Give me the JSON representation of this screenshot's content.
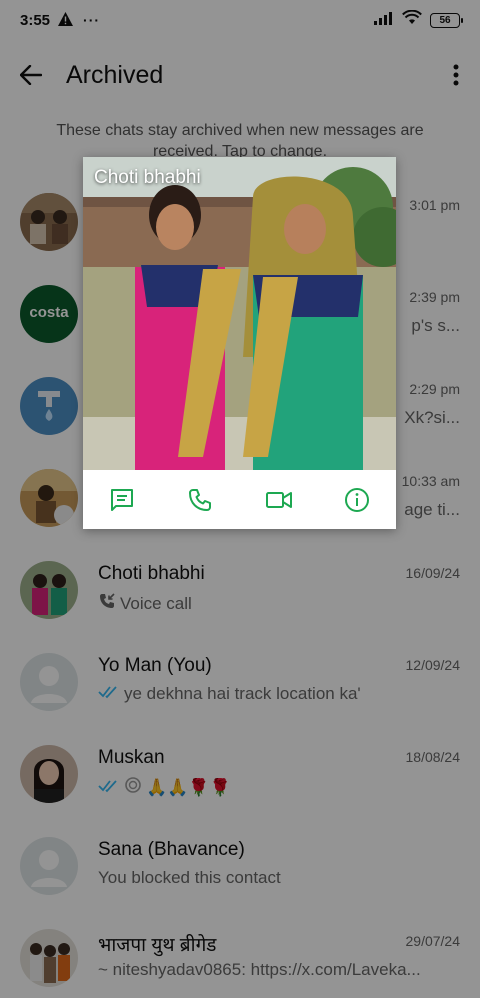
{
  "status_bar": {
    "time": "3:55",
    "battery": "56"
  },
  "header": {
    "title": "Archived"
  },
  "info_text": "These chats stay archived when new messages are received. Tap to change.",
  "chats": [
    {
      "name": "",
      "time": "3:01 pm",
      "preview": ""
    },
    {
      "name": "",
      "time": "2:39 pm",
      "preview": "p's s..."
    },
    {
      "name": "",
      "time": "2:29 pm",
      "preview": "Xk?si..."
    },
    {
      "name": "",
      "time": "10:33 am",
      "preview": "age ti..."
    },
    {
      "name": "Choti bhabhi",
      "time": "16/09/24",
      "preview": "Voice call"
    },
    {
      "name": "Yo Man (You)",
      "time": "12/09/24",
      "preview": "ye dekhna hai track location ka'"
    },
    {
      "name": "Muskan",
      "time": "18/08/24",
      "preview": "🙏🙏🌹🌹"
    },
    {
      "name": "Sana (Bhavance)",
      "time": "",
      "preview": "You blocked this contact"
    },
    {
      "name": "भाजपा युथ ब्रीगेड",
      "time": "29/07/24",
      "preview": "~ niteshyadav0865: https://x.com/Laveka..."
    }
  ],
  "avatar_logo_text": "costa",
  "popup": {
    "name": "Choti bhabhi"
  },
  "colors": {
    "accent": "#1DA851",
    "read_tick": "#34B7F1",
    "scrim": "rgba(0,0,0,0.42)"
  }
}
